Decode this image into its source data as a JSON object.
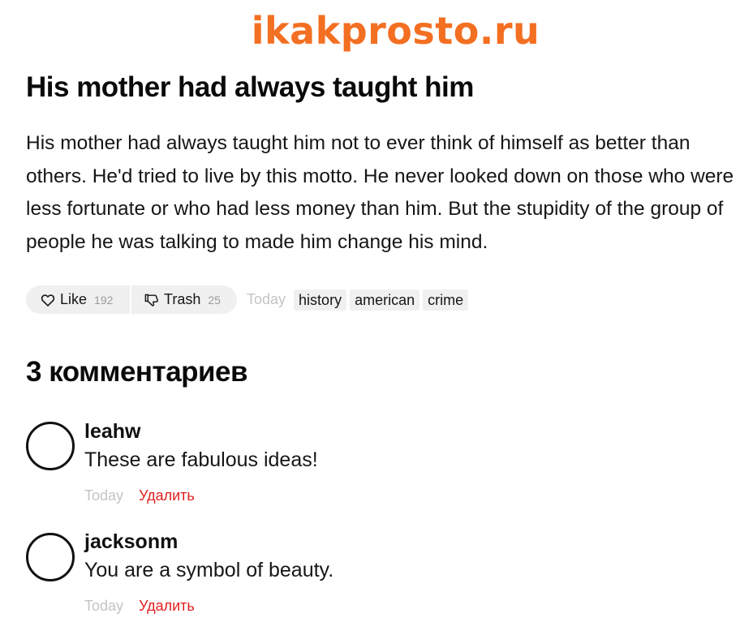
{
  "site": {
    "logo_text": "ikakprosto.ru",
    "brand_color": "#f36f21"
  },
  "post": {
    "title": "His mother had always taught him",
    "body": "His mother had always taught him not to ever think of himself as better than others. He'd tried to live by this motto. He never looked down on those who were less fortunate or who had less money than him. But the stupidity of the group of people he was talking to made him change his mind.",
    "like": {
      "label": "Like",
      "count": "192",
      "icon": "heart-outline-icon"
    },
    "trash": {
      "label": "Trash",
      "count": "25",
      "icon": "thumbs-down-icon"
    },
    "date": "Today",
    "tags": [
      "history",
      "american",
      "crime"
    ]
  },
  "comments": {
    "heading": "3 комментариев",
    "delete_color": "#e02020",
    "items": [
      {
        "author": "leahw",
        "text": "These are fabulous ideas!",
        "date": "Today",
        "delete_label": "Удалить"
      },
      {
        "author": "jacksonm",
        "text": "You are a symbol of beauty.",
        "date": "Today",
        "delete_label": "Удалить"
      }
    ]
  }
}
